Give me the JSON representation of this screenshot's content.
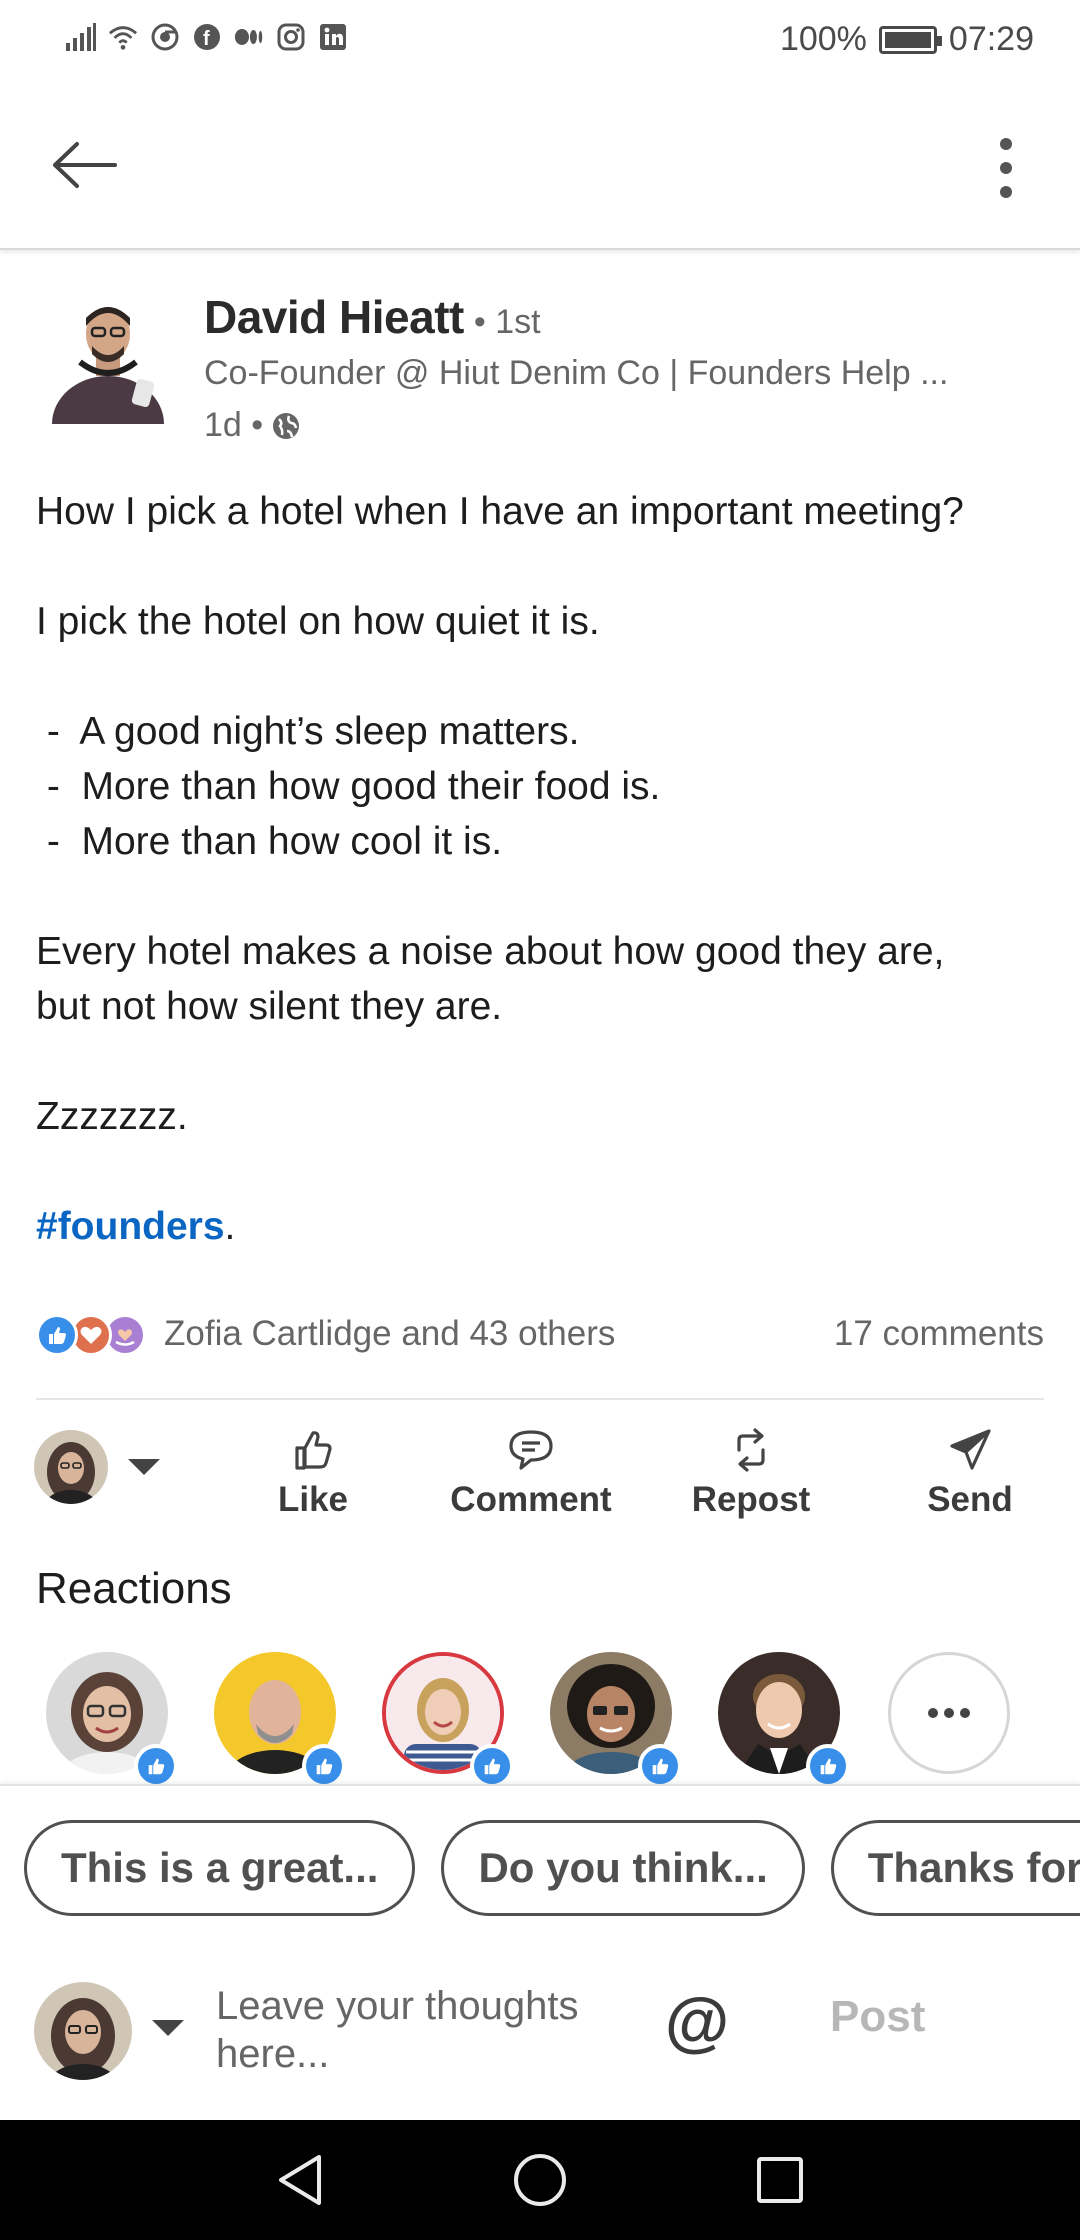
{
  "status_bar": {
    "notification_icons": [
      "signal-icon",
      "wifi-icon",
      "chrome-icon",
      "facebook-icon",
      "medium-icon",
      "instagram-icon",
      "linkedin-icon"
    ],
    "battery": "100%",
    "time": "07:29"
  },
  "header": {
    "back_icon": "arrow-left-icon",
    "menu_icon": "more-vertical-icon"
  },
  "post": {
    "author_name": "David Hieatt",
    "degree": "• 1st",
    "headline": "Co-Founder @ Hiut Denim Co | Founders Help ...",
    "time": "1d •",
    "visibility_icon": "globe-icon",
    "lines": [
      "How I pick a hotel when I have an important meeting?",
      "",
      "I pick the hotel on how quiet it is.",
      "",
      " -  A good night’s sleep matters.",
      " -  More than how good their food is.",
      " -  More than how cool it is.",
      "",
      "Every hotel makes a noise about how good they are,",
      "but not how silent they are.",
      "",
      "Zzzzzzz.",
      ""
    ],
    "hashtag": "#founders",
    "hashtag_suffix": "."
  },
  "social": {
    "reactions_text": "Zofia Cartlidge and 43 others",
    "comments_text": "17 comments",
    "reaction_icons": [
      "like-reaction-icon",
      "love-reaction-icon",
      "support-reaction-icon"
    ]
  },
  "actions": {
    "like": "Like",
    "comment": "Comment",
    "repost": "Repost",
    "send": "Send"
  },
  "reactions_section": {
    "title": "Reactions",
    "more_label": "•••"
  },
  "composer": {
    "chips": [
      "This is a great...",
      "Do you think...",
      "Thanks for sharing"
    ],
    "placeholder": "Leave your thoughts here...",
    "mention": "@",
    "post_label": "Post"
  },
  "colors": {
    "link_blue": "#0a66c2",
    "like_blue": "#378fe9",
    "love_red": "#df704d",
    "support_purple": "#a97fd4"
  }
}
